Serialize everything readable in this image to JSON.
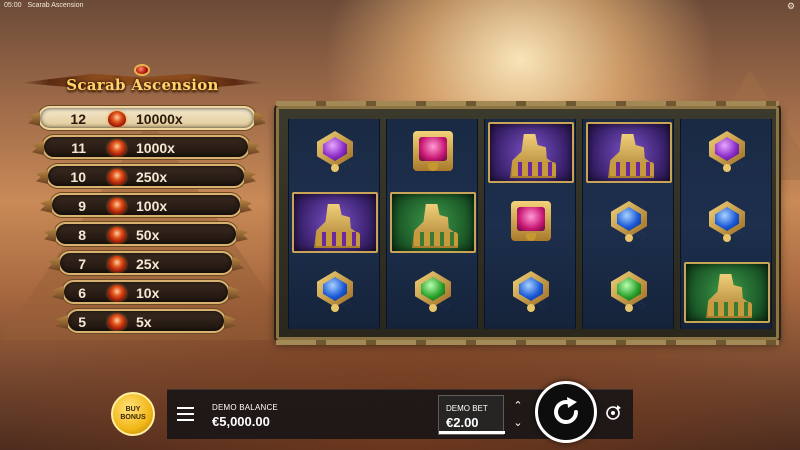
{
  "statusbar": {
    "time": "05:00",
    "title": "Scarab Ascension"
  },
  "game": {
    "logo_text": "Scarab Ascension"
  },
  "paytable": [
    {
      "level": "12",
      "mult": "10000x",
      "active": true
    },
    {
      "level": "11",
      "mult": "1000x",
      "active": false
    },
    {
      "level": "10",
      "mult": "250x",
      "active": false
    },
    {
      "level": "9",
      "mult": "100x",
      "active": false
    },
    {
      "level": "8",
      "mult": "50x",
      "active": false
    },
    {
      "level": "7",
      "mult": "25x",
      "active": false
    },
    {
      "level": "6",
      "mult": "10x",
      "active": false
    },
    {
      "level": "5",
      "mult": "5x",
      "active": false
    }
  ],
  "reels": [
    [
      "purple-amulet",
      "purple-cat-tile",
      "blue-amulet"
    ],
    [
      "pink-tile-gem",
      "green-anubis-tile",
      "green-amulet"
    ],
    [
      "purple-cat-tile",
      "pink-tile-gem",
      "blue-amulet"
    ],
    [
      "purple-cat-tile",
      "blue-amulet",
      "green-amulet"
    ],
    [
      "purple-amulet",
      "blue-amulet",
      "green-anubis-tile"
    ]
  ],
  "controls": {
    "buy_bonus_line1": "BUY",
    "buy_bonus_line2": "BONUS",
    "balance_label": "DEMO BALANCE",
    "balance_value": "€5,000.00",
    "bet_label": "DEMO BET",
    "bet_value": "€2.00"
  },
  "icons": {
    "menu": "hamburger-icon",
    "spin": "spin-arrow-icon",
    "autoplay": "autoplay-icon",
    "settings": "gear-icon"
  }
}
